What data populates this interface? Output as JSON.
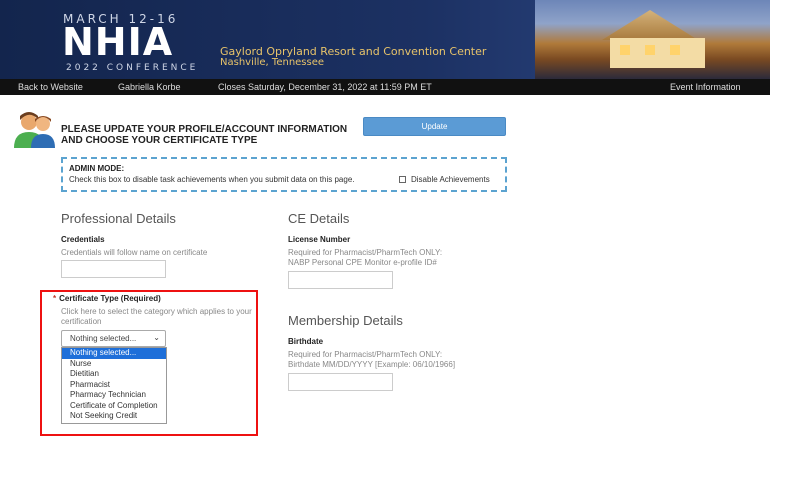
{
  "banner": {
    "date": "MARCH 12-16",
    "logo": "NHIA",
    "subtitle": "2022 CONFERENCE",
    "venue": "Gaylord Opryland Resort and Convention Center",
    "city": "Nashville, Tennessee"
  },
  "nav": {
    "back": "Back to Website",
    "user": "Gabriella Korbe",
    "closes": "Closes Saturday, December 31, 2022 at 11:59 PM ET",
    "info": "Event Information"
  },
  "heading": "PLEASE UPDATE YOUR PROFILE/ACCOUNT INFORMATION AND CHOOSE YOUR CERTIFICATE TYPE",
  "update_label": "Update",
  "admin": {
    "title": "ADMIN MODE:",
    "desc": "Check this box to disable task achievements when you submit data on this page.",
    "checkbox_label": "Disable Achievements"
  },
  "professional": {
    "title": "Professional Details",
    "credentials_label": "Credentials",
    "credentials_help": "Credentials will follow name on certificate",
    "cert_label": "Certificate Type (Required)",
    "cert_help": "Click here to select the category which applies to your certification",
    "cert_selected": "Nothing selected...",
    "cert_options": [
      "Nothing selected...",
      "Nurse",
      "Dietitian",
      "Pharmacist",
      "Pharmacy Technician",
      "Certificate of Completion",
      "Not Seeking Credit"
    ]
  },
  "ce": {
    "title": "CE Details",
    "license_label": "License Number",
    "license_help": "Required for Pharmacist/PharmTech ONLY:",
    "license_help2": "NABP Personal CPE Monitor e-profile ID#"
  },
  "membership": {
    "title": "Membership Details",
    "birthdate_label": "Birthdate",
    "birthdate_help": "Required for Pharmacist/PharmTech ONLY:",
    "birthdate_help2": "Birthdate MM/DD/YYYY [Example: 06/10/1966]"
  }
}
